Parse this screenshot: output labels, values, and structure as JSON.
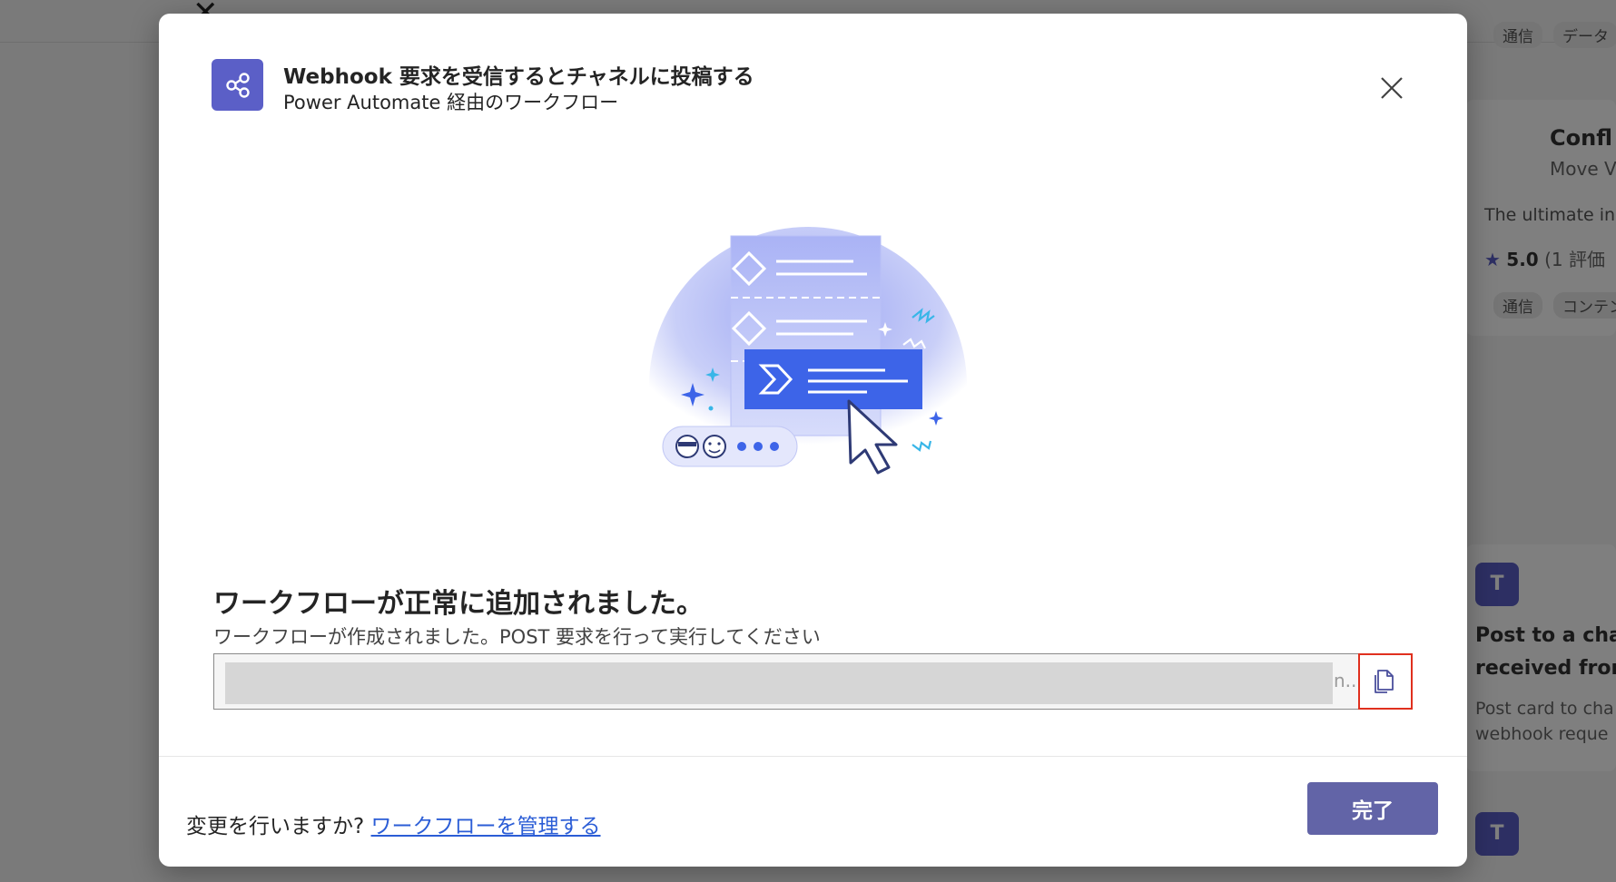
{
  "background": {
    "right_panel": {
      "chips_top": [
        "通信",
        "データ"
      ],
      "card_title": "Confl",
      "card_subtitle": "Move V",
      "card_desc": "The ultimate in",
      "rating": "5.0",
      "rating_count": "(1 評価",
      "chips_bottom": [
        "通信",
        "コンテン"
      ],
      "teams_card_title_line1": "Post to a cha",
      "teams_card_title_line2": "received from",
      "teams_card_desc_line1": "Post card to cha",
      "teams_card_desc_line2": "webhook reque"
    }
  },
  "dialog": {
    "title": "Webhook 要求を受信するとチャネルに投稿する",
    "subtitle": "Power Automate 経由のワークフロー",
    "close_icon": "close-icon",
    "success_heading": "ワークフローが正常に追加されました。",
    "success_description": "ワークフローが作成されました。POST 要求を行って実行してください",
    "url_ellipsis": "n...",
    "copy_icon": "copy-icon",
    "footer": {
      "question": "変更を行いますか?",
      "manage_link": "ワークフローを管理する",
      "done_label": "完了"
    }
  },
  "colors": {
    "accent": "#6264a7",
    "app_icon_bg": "#5b5fc7",
    "link": "#2b5dd6",
    "highlight_border": "#e0301e"
  }
}
